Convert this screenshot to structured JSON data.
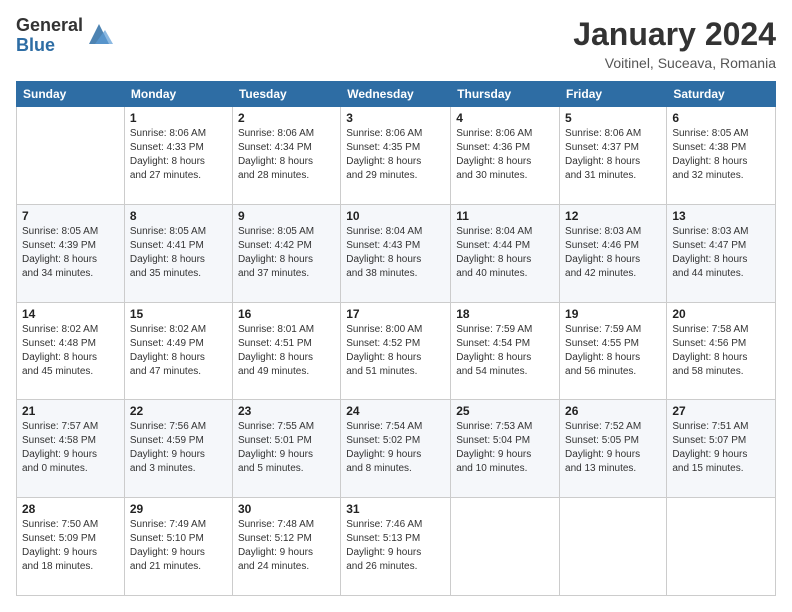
{
  "header": {
    "logo_general": "General",
    "logo_blue": "Blue",
    "title": "January 2024",
    "subtitle": "Voitinel, Suceava, Romania"
  },
  "days_of_week": [
    "Sunday",
    "Monday",
    "Tuesday",
    "Wednesday",
    "Thursday",
    "Friday",
    "Saturday"
  ],
  "weeks": [
    [
      {
        "day": "",
        "info": ""
      },
      {
        "day": "1",
        "info": "Sunrise: 8:06 AM\nSunset: 4:33 PM\nDaylight: 8 hours\nand 27 minutes."
      },
      {
        "day": "2",
        "info": "Sunrise: 8:06 AM\nSunset: 4:34 PM\nDaylight: 8 hours\nand 28 minutes."
      },
      {
        "day": "3",
        "info": "Sunrise: 8:06 AM\nSunset: 4:35 PM\nDaylight: 8 hours\nand 29 minutes."
      },
      {
        "day": "4",
        "info": "Sunrise: 8:06 AM\nSunset: 4:36 PM\nDaylight: 8 hours\nand 30 minutes."
      },
      {
        "day": "5",
        "info": "Sunrise: 8:06 AM\nSunset: 4:37 PM\nDaylight: 8 hours\nand 31 minutes."
      },
      {
        "day": "6",
        "info": "Sunrise: 8:05 AM\nSunset: 4:38 PM\nDaylight: 8 hours\nand 32 minutes."
      }
    ],
    [
      {
        "day": "7",
        "info": "Sunrise: 8:05 AM\nSunset: 4:39 PM\nDaylight: 8 hours\nand 34 minutes."
      },
      {
        "day": "8",
        "info": "Sunrise: 8:05 AM\nSunset: 4:41 PM\nDaylight: 8 hours\nand 35 minutes."
      },
      {
        "day": "9",
        "info": "Sunrise: 8:05 AM\nSunset: 4:42 PM\nDaylight: 8 hours\nand 37 minutes."
      },
      {
        "day": "10",
        "info": "Sunrise: 8:04 AM\nSunset: 4:43 PM\nDaylight: 8 hours\nand 38 minutes."
      },
      {
        "day": "11",
        "info": "Sunrise: 8:04 AM\nSunset: 4:44 PM\nDaylight: 8 hours\nand 40 minutes."
      },
      {
        "day": "12",
        "info": "Sunrise: 8:03 AM\nSunset: 4:46 PM\nDaylight: 8 hours\nand 42 minutes."
      },
      {
        "day": "13",
        "info": "Sunrise: 8:03 AM\nSunset: 4:47 PM\nDaylight: 8 hours\nand 44 minutes."
      }
    ],
    [
      {
        "day": "14",
        "info": "Sunrise: 8:02 AM\nSunset: 4:48 PM\nDaylight: 8 hours\nand 45 minutes."
      },
      {
        "day": "15",
        "info": "Sunrise: 8:02 AM\nSunset: 4:49 PM\nDaylight: 8 hours\nand 47 minutes."
      },
      {
        "day": "16",
        "info": "Sunrise: 8:01 AM\nSunset: 4:51 PM\nDaylight: 8 hours\nand 49 minutes."
      },
      {
        "day": "17",
        "info": "Sunrise: 8:00 AM\nSunset: 4:52 PM\nDaylight: 8 hours\nand 51 minutes."
      },
      {
        "day": "18",
        "info": "Sunrise: 7:59 AM\nSunset: 4:54 PM\nDaylight: 8 hours\nand 54 minutes."
      },
      {
        "day": "19",
        "info": "Sunrise: 7:59 AM\nSunset: 4:55 PM\nDaylight: 8 hours\nand 56 minutes."
      },
      {
        "day": "20",
        "info": "Sunrise: 7:58 AM\nSunset: 4:56 PM\nDaylight: 8 hours\nand 58 minutes."
      }
    ],
    [
      {
        "day": "21",
        "info": "Sunrise: 7:57 AM\nSunset: 4:58 PM\nDaylight: 9 hours\nand 0 minutes."
      },
      {
        "day": "22",
        "info": "Sunrise: 7:56 AM\nSunset: 4:59 PM\nDaylight: 9 hours\nand 3 minutes."
      },
      {
        "day": "23",
        "info": "Sunrise: 7:55 AM\nSunset: 5:01 PM\nDaylight: 9 hours\nand 5 minutes."
      },
      {
        "day": "24",
        "info": "Sunrise: 7:54 AM\nSunset: 5:02 PM\nDaylight: 9 hours\nand 8 minutes."
      },
      {
        "day": "25",
        "info": "Sunrise: 7:53 AM\nSunset: 5:04 PM\nDaylight: 9 hours\nand 10 minutes."
      },
      {
        "day": "26",
        "info": "Sunrise: 7:52 AM\nSunset: 5:05 PM\nDaylight: 9 hours\nand 13 minutes."
      },
      {
        "day": "27",
        "info": "Sunrise: 7:51 AM\nSunset: 5:07 PM\nDaylight: 9 hours\nand 15 minutes."
      }
    ],
    [
      {
        "day": "28",
        "info": "Sunrise: 7:50 AM\nSunset: 5:09 PM\nDaylight: 9 hours\nand 18 minutes."
      },
      {
        "day": "29",
        "info": "Sunrise: 7:49 AM\nSunset: 5:10 PM\nDaylight: 9 hours\nand 21 minutes."
      },
      {
        "day": "30",
        "info": "Sunrise: 7:48 AM\nSunset: 5:12 PM\nDaylight: 9 hours\nand 24 minutes."
      },
      {
        "day": "31",
        "info": "Sunrise: 7:46 AM\nSunset: 5:13 PM\nDaylight: 9 hours\nand 26 minutes."
      },
      {
        "day": "",
        "info": ""
      },
      {
        "day": "",
        "info": ""
      },
      {
        "day": "",
        "info": ""
      }
    ]
  ]
}
